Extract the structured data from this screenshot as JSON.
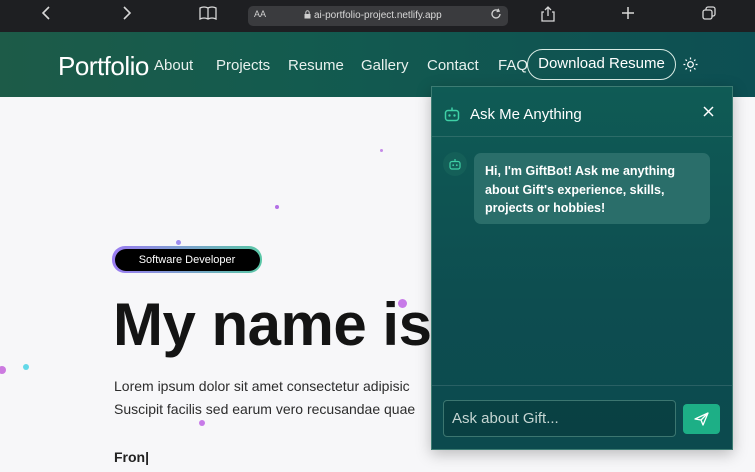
{
  "browser": {
    "back_icon": "chevron-left-icon",
    "forward_icon": "chevron-right-icon",
    "reader_icon": "book-icon",
    "text_size_label": "AA",
    "url": "ai-portfolio-project.netlify.app",
    "share_icon": "share-icon",
    "new_tab_icon": "plus-icon",
    "tabs_icon": "tabs-icon"
  },
  "header": {
    "logo": "Portfolio",
    "nav": [
      "About",
      "Projects",
      "Resume",
      "Gallery",
      "Contact",
      "FAQ"
    ],
    "download_label": "Download Resume",
    "theme_icon": "sun-icon"
  },
  "hero": {
    "role_badge": "Software Developer",
    "title": "My name is",
    "description_line1": "Lorem ipsum dolor sit amet consectetur adipisic",
    "description_line2": "Suscipit facilis sed earum vero recusandae quae",
    "typing_text": "Fron|"
  },
  "chat": {
    "title": "Ask Me Anything",
    "bot_message": "Hi, I'm GiftBot! Ask me anything about Gift's experience, skills, projects or hobbies!",
    "input_placeholder": "Ask about Gift...",
    "send_icon": "send-icon",
    "close_icon": "close-icon"
  },
  "colors": {
    "header_green": "#135b4f",
    "chat_panel": "#0f5b55",
    "send_button": "#1daf86",
    "badge_purple": "#9b7cf2",
    "badge_green": "#5ac7a6"
  }
}
